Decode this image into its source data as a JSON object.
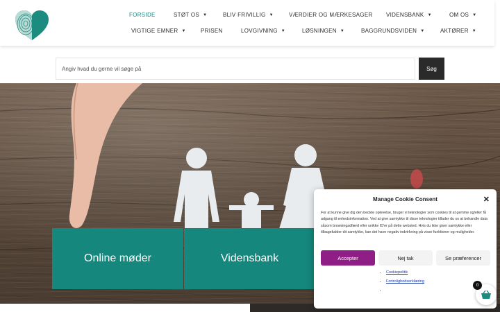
{
  "nav": {
    "row1": [
      {
        "label": "FORSIDE",
        "active": true,
        "dropdown": false
      },
      {
        "label": "STØT OS",
        "active": false,
        "dropdown": true
      },
      {
        "label": "BLIV FRIVILLIG",
        "active": false,
        "dropdown": true
      },
      {
        "label": "VÆRDIER OG MÆRKESAGER",
        "active": false,
        "dropdown": false
      },
      {
        "label": "VIDENSBANK",
        "active": false,
        "dropdown": true
      },
      {
        "label": "OM OS",
        "active": false,
        "dropdown": true
      }
    ],
    "row2": [
      {
        "label": "VIGTIGE EMNER",
        "dropdown": true
      },
      {
        "label": "PRISEN",
        "dropdown": false
      },
      {
        "label": "LOVGIVNING",
        "dropdown": true
      },
      {
        "label": "LØSNINGEN",
        "dropdown": true
      },
      {
        "label": "BAGGRUNDSVIDEN",
        "dropdown": true
      },
      {
        "label": "AKTØRER",
        "dropdown": true
      }
    ],
    "caret": "▼"
  },
  "search": {
    "placeholder": "Angiv hvad du gerne vil søge på",
    "button_label": "Søg"
  },
  "hero": {
    "tiles": [
      "Online møder",
      "Vidensbank"
    ]
  },
  "cookie": {
    "title": "Manage Cookie Consent",
    "close": "✕",
    "body": "For at kunne give dig den bedste oplevelse, bruger vi teknologier som cookies til at gemme og/eller få adgang til enhedsinformation. Ved at give samtykke til disse teknologier tillader du os at behandle data såsom browsingadfærd eller unikke ID'er på dette websted. Hvis du ikke giver samtykke eller tilbagekalder dit samtykke, kan det have negativ indvirkning på visse funktioner og muligheder.",
    "accept": "Accepter",
    "deny": "Nej tak",
    "preferences": "Se præferencer",
    "links": [
      "Cookiepolitik",
      "Fortrolighedserklæring",
      ""
    ]
  },
  "cart": {
    "count": "0",
    "icon": "basket-icon"
  },
  "colors": {
    "accent": "#15877c",
    "active_nav": "#1a8a7e",
    "accept_button": "#8f1f86",
    "search_button": "#2a2a2a"
  }
}
